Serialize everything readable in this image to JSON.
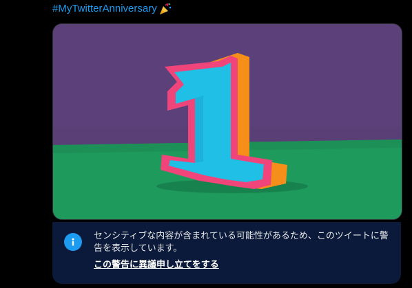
{
  "tweet": {
    "hashtag": "#MyTwitterAnniversary",
    "emoji": "party-popper-icon"
  },
  "media": {
    "subject": "number-one-cutout-image",
    "colors": {
      "wall": "#5a3f76",
      "floor": "#1f9a5d",
      "face": "#1fbfe6",
      "outline": "#f0457a",
      "side": "#f58f1a"
    }
  },
  "sensitive_warning": {
    "message": "センシティブな内容が含まれている可能性があるため、このツイートに警告を表示しています。",
    "appeal_link": "この警告に異議申し立てをする",
    "icon": "info-icon"
  }
}
